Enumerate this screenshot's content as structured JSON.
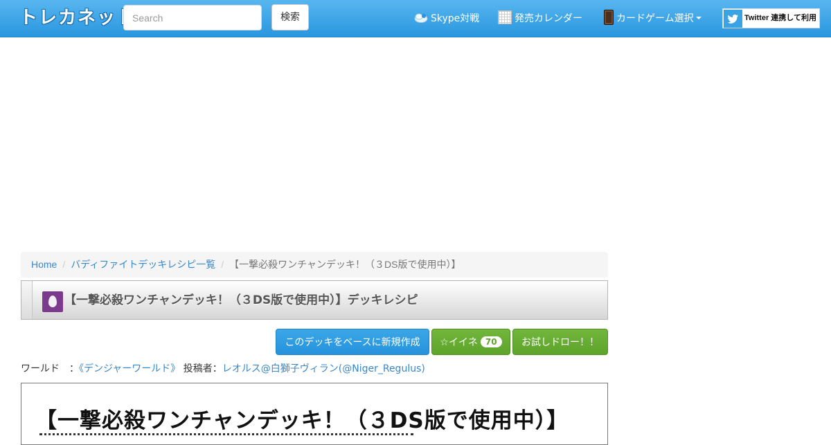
{
  "navbar": {
    "brand": "トレカネット",
    "search_placeholder": "Search",
    "search_button": "検索",
    "skype_label": "Skype対戦",
    "calendar_label": "発売カレンダー",
    "cardgame_label": "カードゲーム選択",
    "twitter_label": "Twitter 連携して利用"
  },
  "breadcrumb": {
    "home": "Home",
    "list": "バディファイトデッキレシピ一覧",
    "current": "【一撃必殺ワンチャンデッキ！（３DS版で使用中）】"
  },
  "deck": {
    "title": "【一撃必殺ワンチャンデッキ！（３DS版で使用中）】デッキレシピ",
    "image_title": "【一撃必殺ワンチャンデッキ！（３DS版で使用中）】"
  },
  "actions": {
    "new_from_deck": "このデッキをベースに新規作成",
    "like_label": "☆イイネ",
    "like_count": "70",
    "trial_draw": "お試しドロー！！"
  },
  "meta": {
    "world_label": "ワールド　：",
    "world_value": "《デンジャーワールド》",
    "poster_label": "投稿者：",
    "poster_value": "レオルス@白獅子ヴィラン(@Niger_Regulus)"
  }
}
